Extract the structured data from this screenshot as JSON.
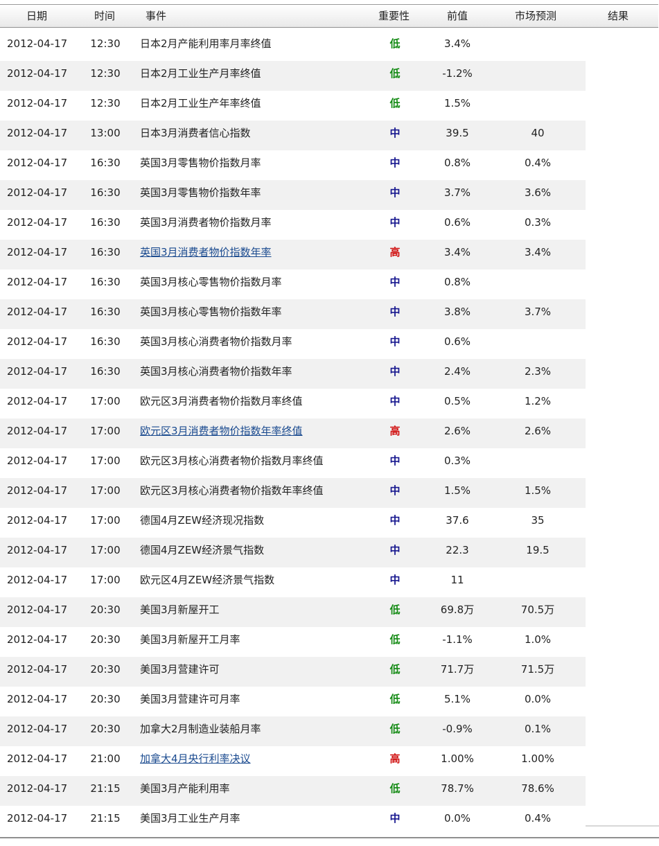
{
  "header": {
    "date": "日期",
    "time": "时间",
    "event": "事件",
    "importance": "重要性",
    "previous": "前值",
    "forecast": "市场预测",
    "result": "结果"
  },
  "colors": {
    "low": "#138a13",
    "medium": "#16168e",
    "high": "#d01010",
    "link": "#1a4a8f"
  },
  "rows": [
    {
      "date": "2012-04-17",
      "time": "12:30",
      "event": "日本2月产能利用率月率终值",
      "importance": "低",
      "level": "low",
      "previous": "3.4%",
      "forecast": "",
      "link": false
    },
    {
      "date": "2012-04-17",
      "time": "12:30",
      "event": "日本2月工业生产月率终值",
      "importance": "低",
      "level": "low",
      "previous": "-1.2%",
      "forecast": "",
      "link": false
    },
    {
      "date": "2012-04-17",
      "time": "12:30",
      "event": "日本2月工业生产年率终值",
      "importance": "低",
      "level": "low",
      "previous": "1.5%",
      "forecast": "",
      "link": false
    },
    {
      "date": "2012-04-17",
      "time": "13:00",
      "event": "日本3月消费者信心指数",
      "importance": "中",
      "level": "mid",
      "previous": "39.5",
      "forecast": "40",
      "link": false
    },
    {
      "date": "2012-04-17",
      "time": "16:30",
      "event": "英国3月零售物价指数月率",
      "importance": "中",
      "level": "mid",
      "previous": "0.8%",
      "forecast": "0.4%",
      "link": false
    },
    {
      "date": "2012-04-17",
      "time": "16:30",
      "event": "英国3月零售物价指数年率",
      "importance": "中",
      "level": "mid",
      "previous": "3.7%",
      "forecast": "3.6%",
      "link": false
    },
    {
      "date": "2012-04-17",
      "time": "16:30",
      "event": "英国3月消费者物价指数月率",
      "importance": "中",
      "level": "mid",
      "previous": "0.6%",
      "forecast": "0.3%",
      "link": false
    },
    {
      "date": "2012-04-17",
      "time": "16:30",
      "event": "英国3月消费者物价指数年率",
      "importance": "高",
      "level": "high",
      "previous": "3.4%",
      "forecast": "3.4%",
      "link": true
    },
    {
      "date": "2012-04-17",
      "time": "16:30",
      "event": "英国3月核心零售物价指数月率",
      "importance": "中",
      "level": "mid",
      "previous": "0.8%",
      "forecast": "",
      "link": false
    },
    {
      "date": "2012-04-17",
      "time": "16:30",
      "event": "英国3月核心零售物价指数年率",
      "importance": "中",
      "level": "mid",
      "previous": "3.8%",
      "forecast": "3.7%",
      "link": false
    },
    {
      "date": "2012-04-17",
      "time": "16:30",
      "event": "英国3月核心消费者物价指数月率",
      "importance": "中",
      "level": "mid",
      "previous": "0.6%",
      "forecast": "",
      "link": false
    },
    {
      "date": "2012-04-17",
      "time": "16:30",
      "event": "英国3月核心消费者物价指数年率",
      "importance": "中",
      "level": "mid",
      "previous": "2.4%",
      "forecast": "2.3%",
      "link": false
    },
    {
      "date": "2012-04-17",
      "time": "17:00",
      "event": "欧元区3月消费者物价指数月率终值",
      "importance": "中",
      "level": "mid",
      "previous": "0.5%",
      "forecast": "1.2%",
      "link": false
    },
    {
      "date": "2012-04-17",
      "time": "17:00",
      "event": "欧元区3月消费者物价指数年率终值",
      "importance": "高",
      "level": "high",
      "previous": "2.6%",
      "forecast": "2.6%",
      "link": true
    },
    {
      "date": "2012-04-17",
      "time": "17:00",
      "event": "欧元区3月核心消费者物价指数月率终值",
      "importance": "中",
      "level": "mid",
      "previous": "0.3%",
      "forecast": "",
      "link": false
    },
    {
      "date": "2012-04-17",
      "time": "17:00",
      "event": "欧元区3月核心消费者物价指数年率终值",
      "importance": "中",
      "level": "mid",
      "previous": "1.5%",
      "forecast": "1.5%",
      "link": false
    },
    {
      "date": "2012-04-17",
      "time": "17:00",
      "event": "德国4月ZEW经济现况指数",
      "importance": "中",
      "level": "mid",
      "previous": "37.6",
      "forecast": "35",
      "link": false
    },
    {
      "date": "2012-04-17",
      "time": "17:00",
      "event": "德国4月ZEW经济景气指数",
      "importance": "中",
      "level": "mid",
      "previous": "22.3",
      "forecast": "19.5",
      "link": false
    },
    {
      "date": "2012-04-17",
      "time": "17:00",
      "event": "欧元区4月ZEW经济景气指数",
      "importance": "中",
      "level": "mid",
      "previous": "11",
      "forecast": "",
      "link": false
    },
    {
      "date": "2012-04-17",
      "time": "20:30",
      "event": "美国3月新屋开工",
      "importance": "低",
      "level": "low",
      "previous": "69.8万",
      "forecast": "70.5万",
      "link": false
    },
    {
      "date": "2012-04-17",
      "time": "20:30",
      "event": "美国3月新屋开工月率",
      "importance": "低",
      "level": "low",
      "previous": "-1.1%",
      "forecast": "1.0%",
      "link": false
    },
    {
      "date": "2012-04-17",
      "time": "20:30",
      "event": "美国3月营建许可",
      "importance": "低",
      "level": "low",
      "previous": "71.7万",
      "forecast": "71.5万",
      "link": false
    },
    {
      "date": "2012-04-17",
      "time": "20:30",
      "event": "美国3月营建许可月率",
      "importance": "低",
      "level": "low",
      "previous": "5.1%",
      "forecast": "0.0%",
      "link": false
    },
    {
      "date": "2012-04-17",
      "time": "20:30",
      "event": "加拿大2月制造业装船月率",
      "importance": "低",
      "level": "low",
      "previous": "-0.9%",
      "forecast": "0.1%",
      "link": false
    },
    {
      "date": "2012-04-17",
      "time": "21:00",
      "event": "加拿大4月央行利率决议",
      "importance": "高",
      "level": "high",
      "previous": "1.00%",
      "forecast": "1.00%",
      "link": true
    },
    {
      "date": "2012-04-17",
      "time": "21:15",
      "event": "美国3月产能利用率",
      "importance": "低",
      "level": "low",
      "previous": "78.7%",
      "forecast": "78.6%",
      "link": false
    },
    {
      "date": "2012-04-17",
      "time": "21:15",
      "event": "美国3月工业生产月率",
      "importance": "中",
      "level": "mid",
      "previous": "0.0%",
      "forecast": "0.4%",
      "link": false
    }
  ]
}
